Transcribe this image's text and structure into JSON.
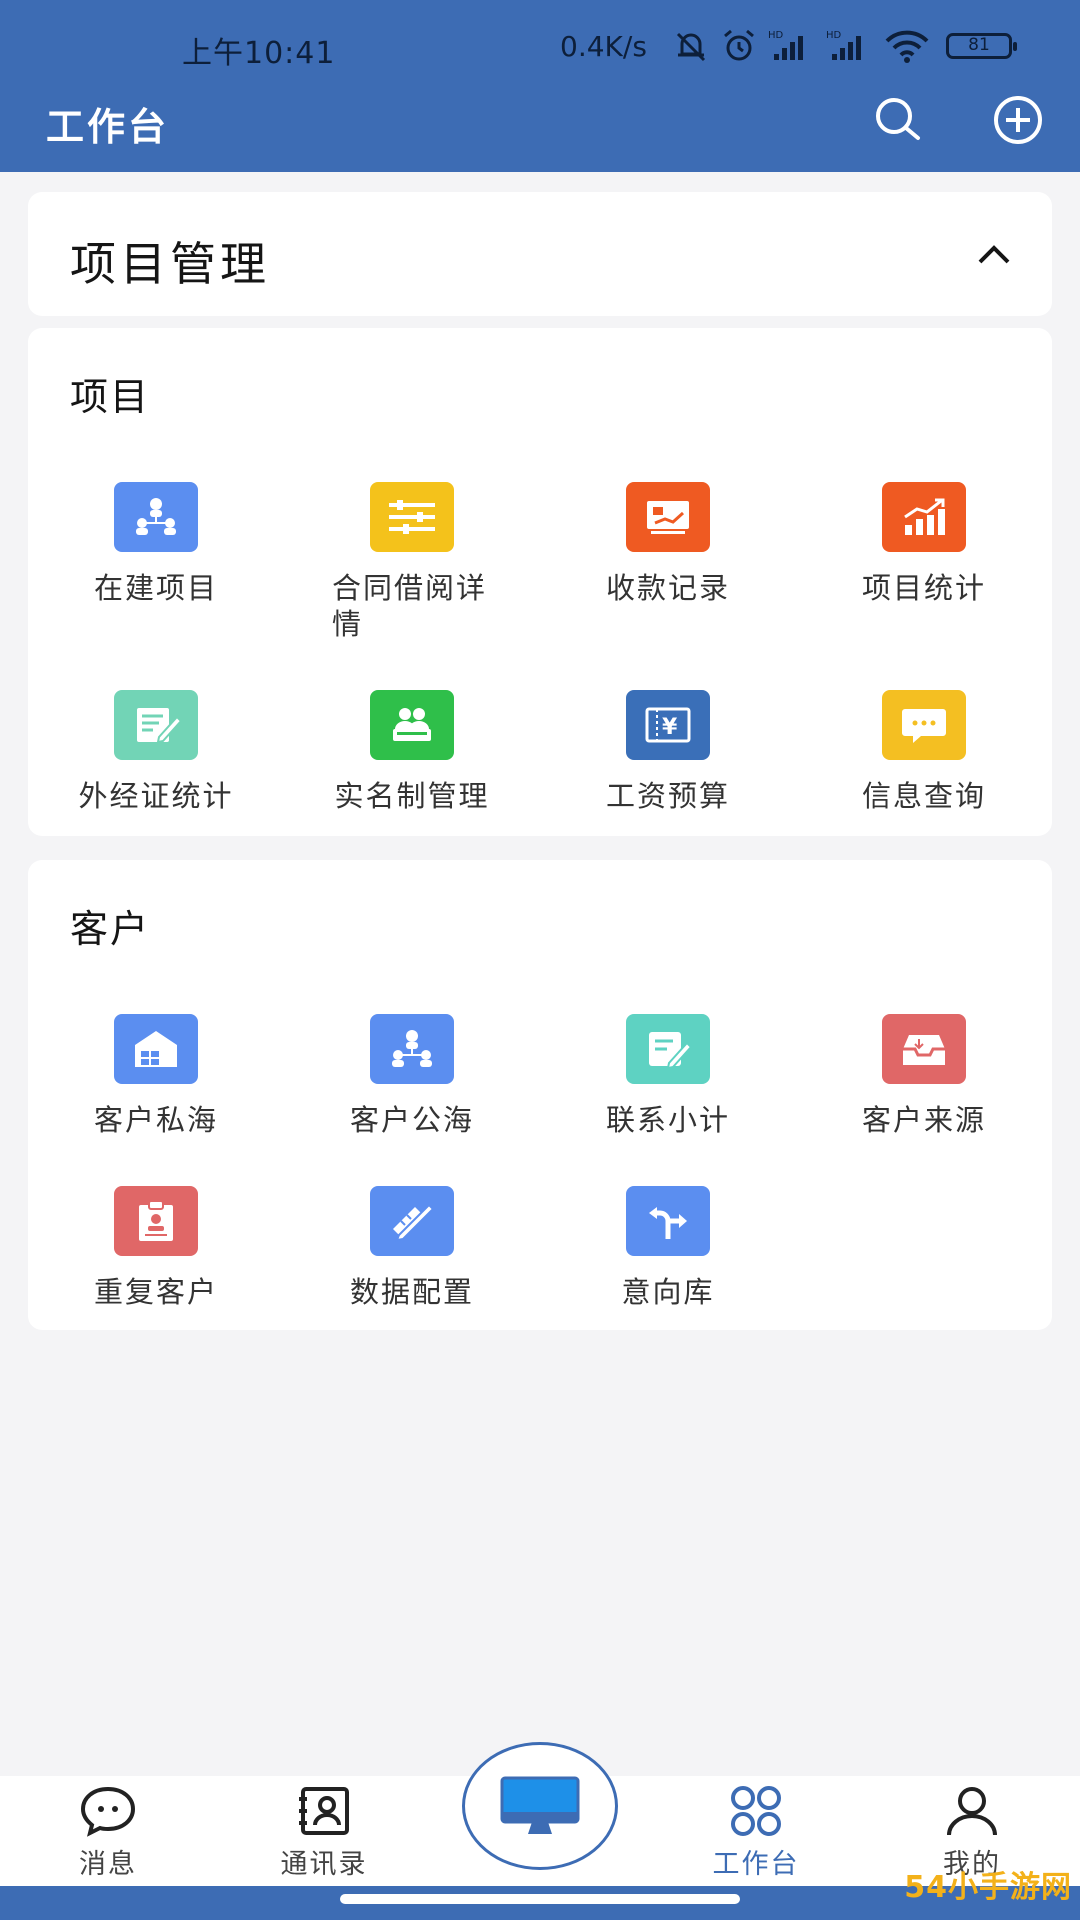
{
  "status_bar": {
    "time": "上午10:41",
    "net_speed": "0.4K/s",
    "battery_level": "81"
  },
  "header": {
    "title": "工作台"
  },
  "module": {
    "title": "项目管理"
  },
  "sections": [
    {
      "title": "项目",
      "items": [
        {
          "label": "在建项目",
          "icon": "project-team-icon",
          "color": "#5b8ef0"
        },
        {
          "label": "合同借阅详情",
          "icon": "sliders-icon",
          "color": "#f4c21b"
        },
        {
          "label": "收款记录",
          "icon": "receipt-board-icon",
          "color": "#ef5a22"
        },
        {
          "label": "项目统计",
          "icon": "bar-chart-icon",
          "color": "#ef5a22"
        },
        {
          "label": "外经证统计",
          "icon": "certificate-edit-icon",
          "color": "#72d4b6"
        },
        {
          "label": "实名制管理",
          "icon": "people-id-icon",
          "color": "#2fbf4a"
        },
        {
          "label": "工资预算",
          "icon": "yen-ticket-icon",
          "color": "#3a6fb8"
        },
        {
          "label": "信息查询",
          "icon": "chat-bubble-icon",
          "color": "#f4bf22"
        }
      ]
    },
    {
      "title": "客户",
      "items": [
        {
          "label": "客户私海",
          "icon": "house-grid-icon",
          "color": "#5b8ef0"
        },
        {
          "label": "客户公海",
          "icon": "team-network-icon",
          "color": "#5b8ef0"
        },
        {
          "label": "联系小计",
          "icon": "note-pen-icon",
          "color": "#5ed2c2"
        },
        {
          "label": "客户来源",
          "icon": "inbox-tray-icon",
          "color": "#e06767"
        },
        {
          "label": "重复客户",
          "icon": "clipboard-user-icon",
          "color": "#e06767"
        },
        {
          "label": "数据配置",
          "icon": "ruler-pencil-icon",
          "color": "#5b8ef0"
        },
        {
          "label": "意向库",
          "icon": "direction-arrow-icon",
          "color": "#5b8ef0"
        }
      ]
    }
  ],
  "tabbar": {
    "items": [
      {
        "label": "消息",
        "icon": "message-icon"
      },
      {
        "label": "通讯录",
        "icon": "contacts-icon"
      },
      {
        "label": "工作台",
        "icon": "workbench-grid-icon",
        "active": true
      },
      {
        "label": "我的",
        "icon": "profile-icon"
      }
    ],
    "center_icon": "monitor-icon",
    "active_color": "#3d6cb4"
  },
  "watermark": "54小手游网"
}
